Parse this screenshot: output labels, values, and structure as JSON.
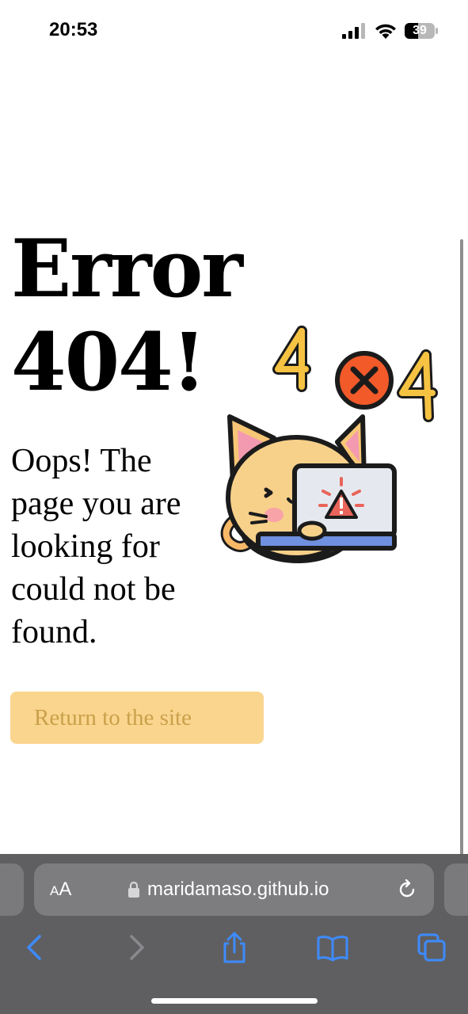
{
  "status_bar": {
    "time": "20:53",
    "battery_level": "39"
  },
  "page": {
    "title_line1": "Error",
    "title_line2": "404!",
    "message": "Oops! The page you are looking for could not be found.",
    "return_button_label": "Return to the site",
    "illustration": {
      "badge_text": "4",
      "description_icon": "cat-laptop-404-icon"
    }
  },
  "browser": {
    "text_size_label": "AA",
    "url": "maridamaso.github.io",
    "icons": [
      "lock-icon",
      "reload-icon",
      "back-icon",
      "forward-icon",
      "share-icon",
      "bookmarks-icon",
      "tabs-icon"
    ]
  },
  "colors": {
    "button_bg": "#fad58e",
    "button_text": "#caa04a",
    "toolbar_bg": "#5f5f61",
    "accent_blue": "#3d8bfd"
  }
}
